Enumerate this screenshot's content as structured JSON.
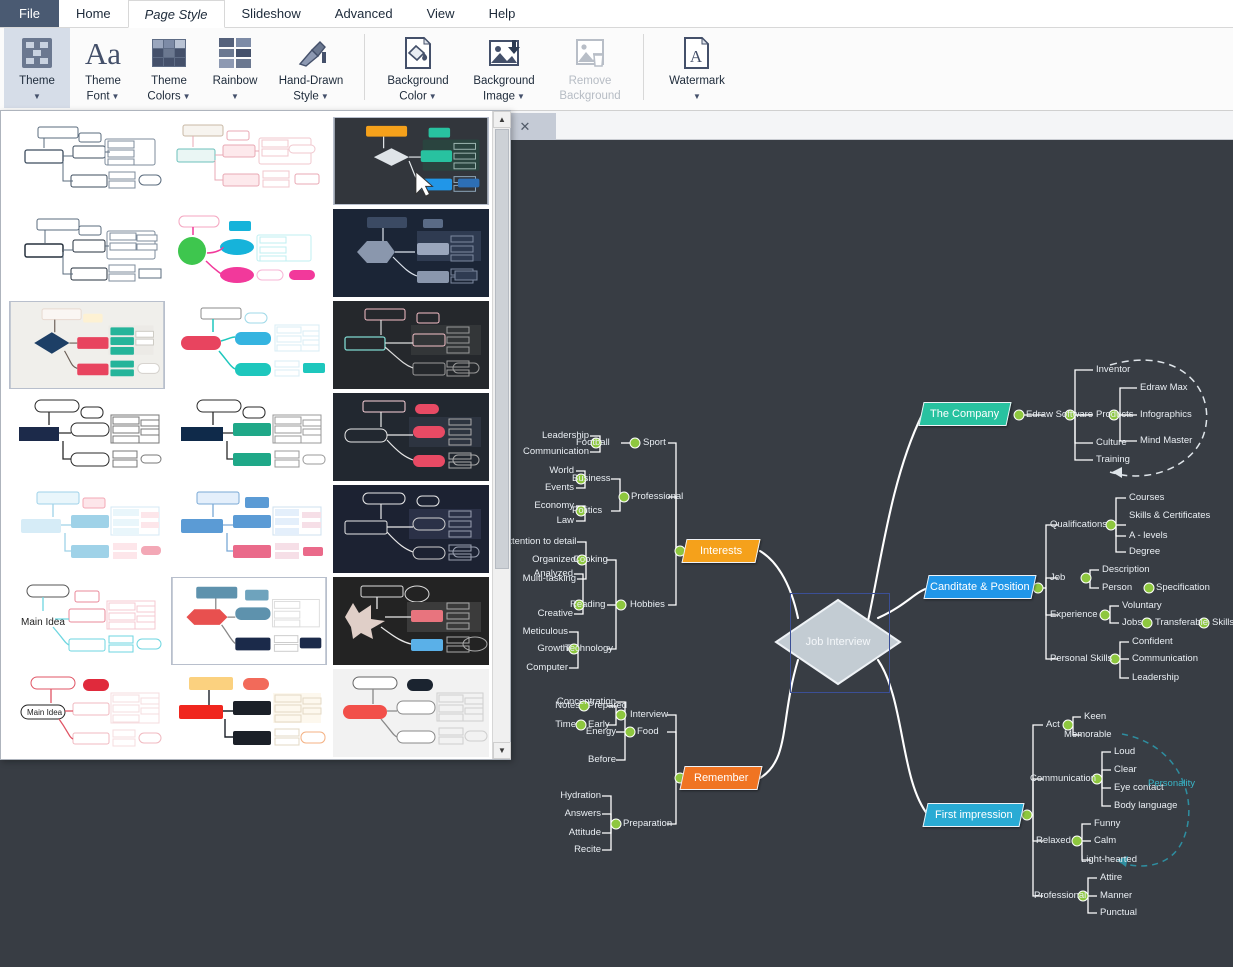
{
  "menubar": {
    "items": [
      {
        "label": "File",
        "id": "file",
        "state": "file"
      },
      {
        "label": "Home",
        "id": "home",
        "state": "normal"
      },
      {
        "label": "Page Style",
        "id": "page-style",
        "state": "active"
      },
      {
        "label": "Slideshow",
        "id": "slideshow",
        "state": "normal"
      },
      {
        "label": "Advanced",
        "id": "advanced",
        "state": "normal"
      },
      {
        "label": "View",
        "id": "view",
        "state": "normal"
      },
      {
        "label": "Help",
        "id": "help",
        "state": "normal"
      }
    ]
  },
  "ribbon": {
    "buttons": [
      {
        "id": "theme",
        "line1": "Theme",
        "line2": "",
        "icon": "theme-icon",
        "selected": true,
        "disabled": false,
        "caret": true
      },
      {
        "id": "theme-font",
        "line1": "Theme",
        "line2": "Font",
        "icon": "theme-font-icon",
        "selected": false,
        "disabled": false,
        "caret": true
      },
      {
        "id": "theme-colors",
        "line1": "Theme",
        "line2": "Colors",
        "icon": "theme-colors-icon",
        "selected": false,
        "disabled": false,
        "caret": true
      },
      {
        "id": "rainbow",
        "line1": "Rainbow",
        "line2": "",
        "icon": "rainbow-icon",
        "selected": false,
        "disabled": false,
        "caret": true
      },
      {
        "id": "hand-drawn-style",
        "line1": "Hand-Drawn",
        "line2": "Style",
        "icon": "hand-drawn-icon",
        "selected": false,
        "disabled": false,
        "caret": true
      },
      {
        "id": "background-color",
        "line1": "Background",
        "line2": "Color",
        "icon": "background-color-icon",
        "selected": false,
        "disabled": false,
        "caret": true
      },
      {
        "id": "background-image",
        "line1": "Background",
        "line2": "Image",
        "icon": "background-image-icon",
        "selected": false,
        "disabled": false,
        "caret": true
      },
      {
        "id": "remove-background",
        "line1": "Remove",
        "line2": "Background",
        "icon": "remove-background-icon",
        "selected": false,
        "disabled": true,
        "caret": false
      },
      {
        "id": "watermark",
        "line1": "Watermark",
        "line2": "",
        "icon": "watermark-icon",
        "selected": false,
        "disabled": false,
        "caret": true
      }
    ]
  },
  "doctab": {
    "close_label": "✕"
  },
  "gallery": {
    "scroll_up": "▲",
    "scroll_down": "▼",
    "thumbnails": [
      {
        "id": "theme-1",
        "name": "white-classic",
        "bg": "#ffffff",
        "selected": false
      },
      {
        "id": "theme-2",
        "name": "white-pink-soft",
        "bg": "#ffffff",
        "selected": false
      },
      {
        "id": "theme-3",
        "name": "dark-teal-orange",
        "bg": "#32363c",
        "selected": true
      },
      {
        "id": "theme-4",
        "name": "white-outline",
        "bg": "#ffffff",
        "selected": false
      },
      {
        "id": "theme-5",
        "name": "white-green-pink",
        "bg": "#ffffff",
        "selected": false
      },
      {
        "id": "theme-6",
        "name": "navy-grey",
        "bg": "#1b2536",
        "selected": false
      },
      {
        "id": "theme-7",
        "name": "grey-navy-diamond",
        "bg": "#f0efeb",
        "selected": false
      },
      {
        "id": "theme-8",
        "name": "white-crimson-teal",
        "bg": "#ffffff",
        "selected": false
      },
      {
        "id": "theme-9",
        "name": "black-outline-pink",
        "bg": "#25282c",
        "selected": false
      },
      {
        "id": "theme-10",
        "name": "white-navy-block",
        "bg": "#ffffff",
        "selected": false
      },
      {
        "id": "theme-11",
        "name": "white-navy-green",
        "bg": "#ffffff",
        "selected": false
      },
      {
        "id": "theme-12",
        "name": "dark-pink-round",
        "bg": "#222830",
        "selected": false
      },
      {
        "id": "theme-13",
        "name": "white-cyan-pink",
        "bg": "#ffffff",
        "selected": false
      },
      {
        "id": "theme-14",
        "name": "white-blue-boxes",
        "bg": "#ffffff",
        "selected": false
      },
      {
        "id": "theme-15",
        "name": "navy-rounded",
        "bg": "#1c2232",
        "selected": false
      },
      {
        "id": "theme-16",
        "name": "white-cyan-coral",
        "bg": "#ffffff",
        "selected": false
      },
      {
        "id": "theme-17",
        "name": "white-red-blue-hex",
        "bg": "#ffffff",
        "selected": true
      },
      {
        "id": "theme-18",
        "name": "black-starburst",
        "bg": "#232323",
        "selected": false
      },
      {
        "id": "theme-19",
        "name": "white-red-oval",
        "bg": "#ffffff",
        "selected": false
      },
      {
        "id": "theme-20",
        "name": "cream-red-black",
        "bg": "#ffffff",
        "selected": false
      },
      {
        "id": "theme-21",
        "name": "light-grey-red",
        "bg": "#f2f2f2",
        "selected": false
      }
    ]
  },
  "mindmap": {
    "center": {
      "label": "Job Interview",
      "shape": "diamond",
      "fill": "#c3ccd3",
      "selected": true
    },
    "branches": [
      {
        "id": "the-company",
        "label": "The Company",
        "color": "#28c2a0",
        "side": "right",
        "children": [
          {
            "label": "Edraw Software",
            "children": [
              {
                "label": "Inventor",
                "children": []
              },
              {
                "label": "Products",
                "children": [
                  {
                    "label": "Edraw Max",
                    "children": []
                  },
                  {
                    "label": "Infographics",
                    "children": []
                  },
                  {
                    "label": "Mind Master",
                    "children": []
                  }
                ]
              },
              {
                "label": "Culture",
                "children": []
              },
              {
                "label": "Training",
                "children": []
              }
            ]
          }
        ],
        "callout": {
          "label": "",
          "style": "dashed-loop",
          "color": "#ffffff"
        }
      },
      {
        "id": "candidate-position",
        "label": "Canditate & Position",
        "color": "#2196e8",
        "side": "right",
        "children": [
          {
            "label": "Qualifications",
            "children": [
              {
                "label": "Courses",
                "children": []
              },
              {
                "label": "Skills & Certificates",
                "children": []
              },
              {
                "label": "A - levels",
                "children": []
              },
              {
                "label": "Degree",
                "children": []
              }
            ]
          },
          {
            "label": "Job",
            "children": [
              {
                "label": "Description",
                "children": []
              },
              {
                "label": "Person",
                "children": [
                  {
                    "label": "Specification",
                    "children": []
                  }
                ]
              }
            ]
          },
          {
            "label": "Experience",
            "children": [
              {
                "label": "Voluntary",
                "children": []
              },
              {
                "label": "Jobs",
                "children": [
                  {
                    "label": "Transferable",
                    "children": [
                      {
                        "label": "Skills",
                        "children": []
                      }
                    ]
                  }
                ]
              }
            ]
          },
          {
            "label": "Personal Skills",
            "children": [
              {
                "label": "Confident",
                "children": []
              },
              {
                "label": "Communication",
                "children": []
              },
              {
                "label": "Leadership",
                "children": []
              }
            ]
          }
        ]
      },
      {
        "id": "first-impression",
        "label": "First impression",
        "color": "#29abd4",
        "side": "right",
        "children": [
          {
            "label": "Act",
            "children": [
              {
                "label": "Keen",
                "children": []
              },
              {
                "label": "Memorable",
                "children": []
              }
            ]
          },
          {
            "label": "Communication",
            "children": [
              {
                "label": "Loud",
                "children": []
              },
              {
                "label": "Clear",
                "children": []
              },
              {
                "label": "Eye contact",
                "children": []
              },
              {
                "label": "Body language",
                "children": []
              }
            ]
          },
          {
            "label": "Relaxed",
            "children": [
              {
                "label": "Funny",
                "children": []
              },
              {
                "label": "Calm",
                "children": []
              },
              {
                "label": "Light-hearted",
                "children": []
              }
            ]
          },
          {
            "label": "Professional",
            "children": [
              {
                "label": "Attire",
                "children": []
              },
              {
                "label": "Manner",
                "children": []
              },
              {
                "label": "Punctual",
                "children": []
              }
            ]
          }
        ],
        "callout": {
          "label": "Personality",
          "style": "dashed-loop",
          "color": "#2f9aad"
        }
      },
      {
        "id": "interests",
        "label": "Interests",
        "color": "#f5a11b",
        "side": "left",
        "children": [
          {
            "label": "Sport",
            "children": [
              {
                "label": "Football",
                "children": [
                  {
                    "label": "Leadership",
                    "children": []
                  },
                  {
                    "label": "Communication",
                    "children": []
                  }
                ]
              }
            ]
          },
          {
            "label": "Professional",
            "children": [
              {
                "label": "Business",
                "children": [
                  {
                    "label": "World",
                    "children": []
                  },
                  {
                    "label": "Events",
                    "children": []
                  }
                ]
              },
              {
                "label": "Politics",
                "children": [
                  {
                    "label": "Economy",
                    "children": []
                  },
                  {
                    "label": "Law",
                    "children": []
                  }
                ]
              }
            ]
          },
          {
            "label": "Hobbies",
            "children": [
              {
                "label": "Cooking",
                "children": [
                  {
                    "label": "Attention to detail",
                    "children": []
                  },
                  {
                    "label": "Organized",
                    "children": []
                  },
                  {
                    "label": "Multi-tasking",
                    "children": []
                  }
                ]
              },
              {
                "label": "Reading",
                "children": [
                  {
                    "label": "Analyzed",
                    "children": []
                  },
                  {
                    "label": "Creative",
                    "children": []
                  }
                ]
              },
              {
                "label": "Technology",
                "children": [
                  {
                    "label": "Meticulous",
                    "children": []
                  },
                  {
                    "label": "Growth",
                    "children": []
                  },
                  {
                    "label": "Computer",
                    "children": []
                  }
                ]
              }
            ]
          }
        ]
      },
      {
        "id": "remember",
        "label": "Remember",
        "color": "#f07422",
        "side": "left",
        "children": [
          {
            "label": "Interview",
            "children": [
              {
                "label": "Prepared",
                "children": [
                  {
                    "label": "Notes",
                    "children": []
                  }
                ]
              },
              {
                "label": "Early",
                "children": [
                  {
                    "label": "Time",
                    "children": []
                  }
                ]
              }
            ]
          },
          {
            "label": "Food",
            "children": [
              {
                "label": "Concentration",
                "children": []
              },
              {
                "label": "Energy",
                "children": []
              },
              {
                "label": "Before",
                "children": []
              }
            ]
          },
          {
            "label": "Preparation",
            "children": [
              {
                "label": "Hydration",
                "children": []
              },
              {
                "label": "Answers",
                "children": []
              },
              {
                "label": "Attitude",
                "children": []
              },
              {
                "label": "Recite",
                "children": []
              }
            ]
          }
        ]
      }
    ]
  },
  "colors": {
    "canvas_bg": "#383d44",
    "connector": "#ffffff",
    "collapse_node": "#8ec73f",
    "selection": "#3b4f96",
    "ribbon_bg": "#fbfbfb",
    "file_tab": "#4a5a72"
  }
}
